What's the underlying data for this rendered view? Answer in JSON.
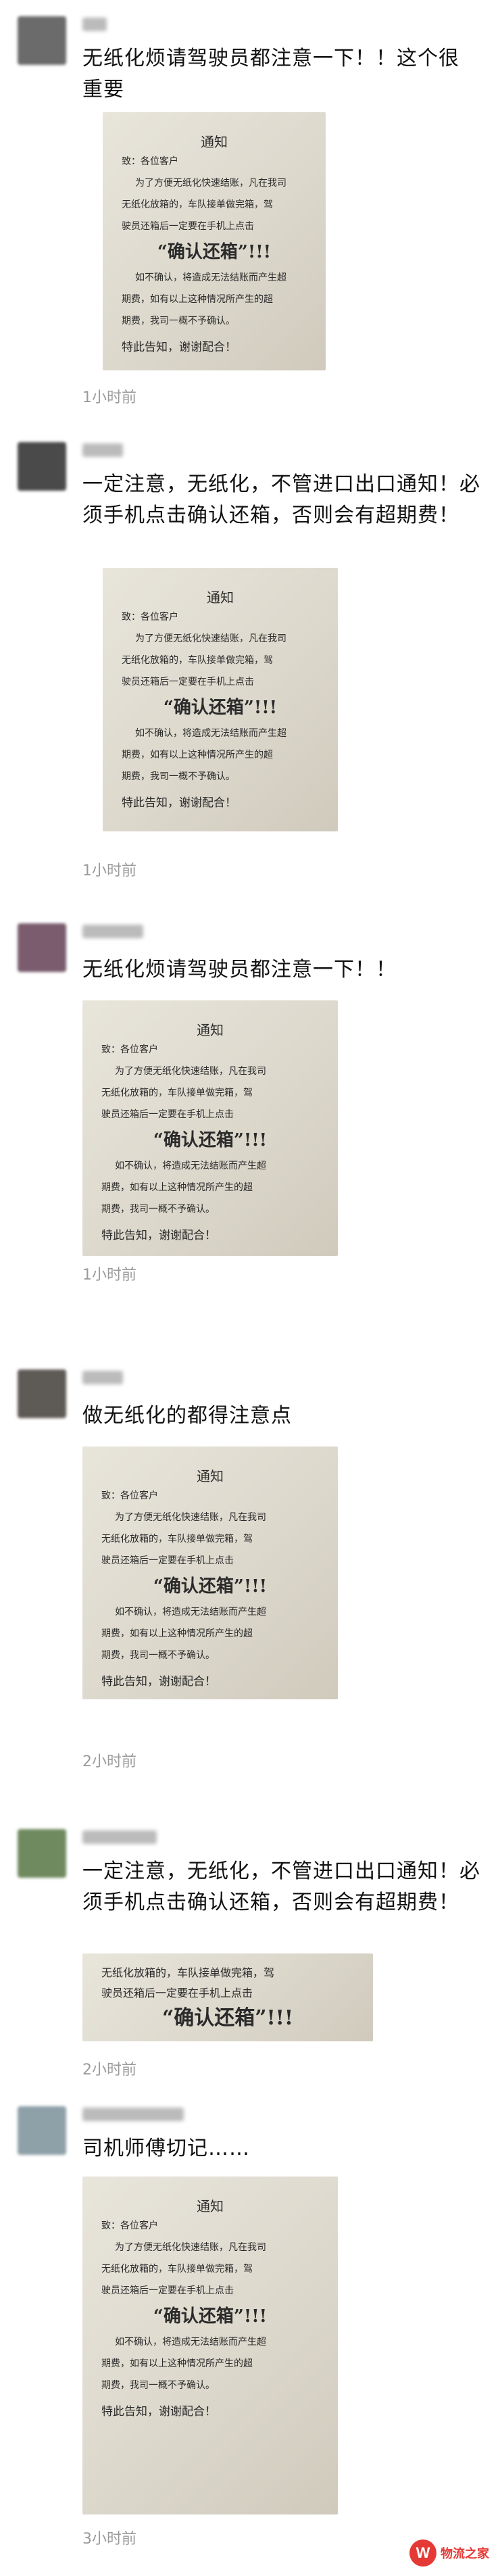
{
  "posts": [
    {
      "message": "无纸化烦请驾驶员都注意一下！！这个很重要",
      "time": "1小时前",
      "avatar_color": "#6b6b6b",
      "notice": {
        "title": "通知",
        "greeting": "致：各位客户",
        "lines": [
          "为了方便无纸化快速结账，凡在我司",
          "无纸化放箱的，车队接单做完箱，驾",
          "驶员还箱后一定要在手机上点击"
        ],
        "confirm": "“确认还箱”!!!",
        "warn_lines": [
          "如不确认，将造成无法结账而产生超",
          "期费，如有以上这种情况所产生的超",
          "期费，我司一概不予确认。"
        ],
        "footer": "特此告知，谢谢配合！"
      }
    },
    {
      "message": "一定注意，无纸化，不管进口出口通知！必须手机点击确认还箱，否则会有超期费！",
      "time": "1小时前",
      "avatar_color": "#4a4a4a",
      "notice": {
        "title": "通知",
        "greeting": "致：各位客户",
        "lines": [
          "为了方便无纸化快速结账，凡在我司",
          "无纸化放箱的，车队接单做完箱，驾",
          "驶员还箱后一定要在手机上点击"
        ],
        "confirm": "“确认还箱”!!!",
        "warn_lines": [
          "如不确认，将造成无法结账而产生超",
          "期费，如有以上这种情况所产生的超",
          "期费，我司一概不予确认。"
        ],
        "footer": "特此告知，谢谢配合！"
      }
    },
    {
      "message": "无纸化烦请驾驶员都注意一下！！",
      "time": "1小时前",
      "avatar_color": "#7a5c6e",
      "notice": {
        "title": "通知",
        "greeting": "致：各位客户",
        "lines": [
          "为了方便无纸化快速结账，凡在我司",
          "无纸化放箱的，车队接单做完箱，驾",
          "驶员还箱后一定要在手机上点击"
        ],
        "confirm": "“确认还箱”!!!",
        "warn_lines": [
          "如不确认，将造成无法结账而产生超",
          "期费，如有以上这种情况所产生的超",
          "期费，我司一概不予确认。"
        ],
        "footer": "特此告知，谢谢配合！"
      }
    },
    {
      "message": "做无纸化的都得注意点",
      "time": "2小时前",
      "avatar_color": "#5e5a56",
      "notice": {
        "title": "通知",
        "greeting": "致：各位客户",
        "lines": [
          "为了方便无纸化快速结账，凡在我司",
          "无纸化放箱的，车队接单做完箱，驾",
          "驶员还箱后一定要在手机上点击"
        ],
        "confirm": "“确认还箱”!!!",
        "warn_lines": [
          "如不确认，将造成无法结账而产生超",
          "期费，如有以上这种情况所产生的超",
          "期费，我司一概不予确认。"
        ],
        "footer": "特此告知，谢谢配合！"
      }
    },
    {
      "message": "一定注意，无纸化，不管进口出口通知！必须手机点击确认还箱，否则会有超期费！",
      "time": "2小时前",
      "avatar_color": "#6f8a5e",
      "notice": {
        "lines": [
          "无纸化放箱的，车队接单做完箱，驾",
          "驶员还箱后一定要在手机上点击"
        ],
        "confirm": "“确认还箱”!!!"
      }
    },
    {
      "message": "司机师傅切记……",
      "time": "3小时前",
      "avatar_color": "#8ea0a8",
      "notice": {
        "title": "通知",
        "greeting": "致：各位客户",
        "lines": [
          "为了方便无纸化快速结账，凡在我司",
          "无纸化放箱的，车队接单做完箱，驾",
          "驶员还箱后一定要在手机上点击"
        ],
        "confirm": "“确认还箱”!!!",
        "warn_lines": [
          "如不确认，将造成无法结账而产生超",
          "期费，如有以上这种情况所产生的超",
          "期费，我司一概不予确认。"
        ],
        "footer": "特此告知，谢谢配合！"
      }
    }
  ],
  "watermark": {
    "text": "物流之家",
    "logo_letter": "W"
  }
}
